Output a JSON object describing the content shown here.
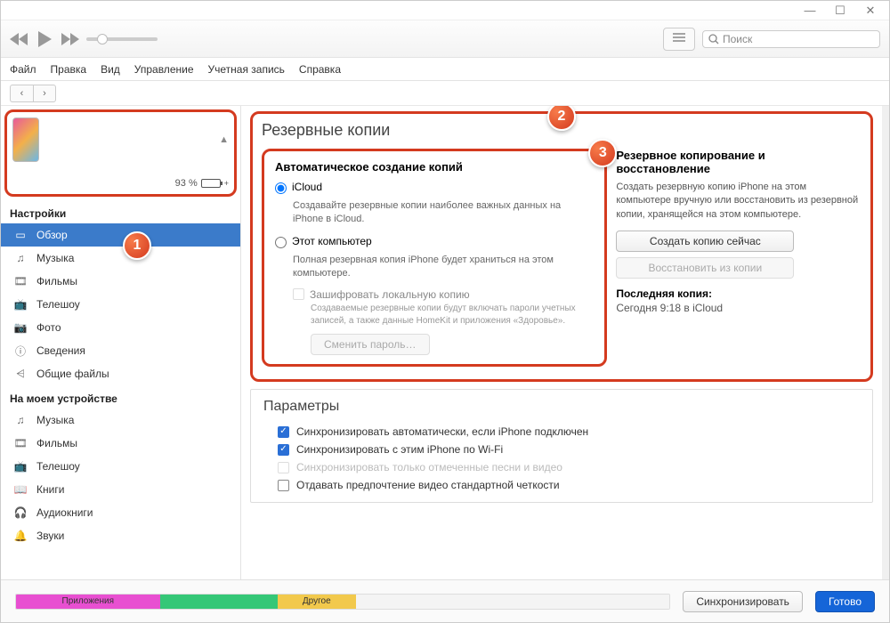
{
  "window_controls": {
    "min": "—",
    "max": "☐",
    "close": "✕"
  },
  "toolbar": {
    "apple": ""
  },
  "search": {
    "placeholder": "Поиск"
  },
  "menubar": [
    "Файл",
    "Правка",
    "Вид",
    "Управление",
    "Учетная запись",
    "Справка"
  ],
  "device": {
    "battery_pct": "93 %",
    "charging": "⚡"
  },
  "sidebar": {
    "settings_header": "Настройки",
    "settings": [
      {
        "icon": "overview",
        "label": "Обзор",
        "selected": true
      },
      {
        "icon": "music",
        "label": "Музыка"
      },
      {
        "icon": "movies",
        "label": "Фильмы"
      },
      {
        "icon": "tv",
        "label": "Телешоу"
      },
      {
        "icon": "photo",
        "label": "Фото"
      },
      {
        "icon": "info",
        "label": "Сведения"
      },
      {
        "icon": "files",
        "label": "Общие файлы"
      }
    ],
    "device_header": "На моем устройстве",
    "ondevice": [
      {
        "icon": "music",
        "label": "Музыка"
      },
      {
        "icon": "movies",
        "label": "Фильмы"
      },
      {
        "icon": "tv",
        "label": "Телешоу"
      },
      {
        "icon": "books",
        "label": "Книги"
      },
      {
        "icon": "audiobooks",
        "label": "Аудиокниги"
      },
      {
        "icon": "tones",
        "label": "Звуки"
      }
    ]
  },
  "callouts": {
    "one": "1",
    "two": "2",
    "three": "3"
  },
  "backup": {
    "title": "Резервные копии",
    "auto": {
      "title": "Автоматическое создание копий",
      "icloud_label": "iCloud",
      "icloud_hint": "Создавайте резервные копии наиболее важных данных на iPhone в iCloud.",
      "local_label": "Этот компьютер",
      "local_hint": "Полная резервная копия iPhone будет храниться на этом компьютере.",
      "encrypt_label": "Зашифровать локальную копию",
      "encrypt_hint": "Создаваемые резервные копии будут включать пароли учетных записей, а также данные HomeKit и приложения «Здоровье».",
      "change_pw": "Сменить пароль…"
    },
    "right": {
      "title": "Резервное копирование и восстановление",
      "desc": "Создать резервную копию iPhone на этом компьютере вручную или восстановить из резервной копии, хранящейся на этом компьютере.",
      "backup_now": "Создать копию сейчас",
      "restore": "Восстановить из копии",
      "last_label": "Последняя копия:",
      "last_value": "Сегодня 9:18 в iCloud"
    }
  },
  "params": {
    "title": "Параметры",
    "opts": [
      {
        "checked": true,
        "disabled": false,
        "label": "Синхронизировать автоматически, если iPhone подключен"
      },
      {
        "checked": true,
        "disabled": false,
        "label": "Синхронизировать с этим iPhone по Wi-Fi"
      },
      {
        "checked": false,
        "disabled": true,
        "label": "Синхронизировать только отмеченные песни и видео"
      },
      {
        "checked": false,
        "disabled": false,
        "label": "Отдавать предпочтение видео стандартной четкости"
      }
    ]
  },
  "footer": {
    "apps": "Приложения",
    "other": "Другое",
    "sync": "Синхронизировать",
    "done": "Готово"
  }
}
